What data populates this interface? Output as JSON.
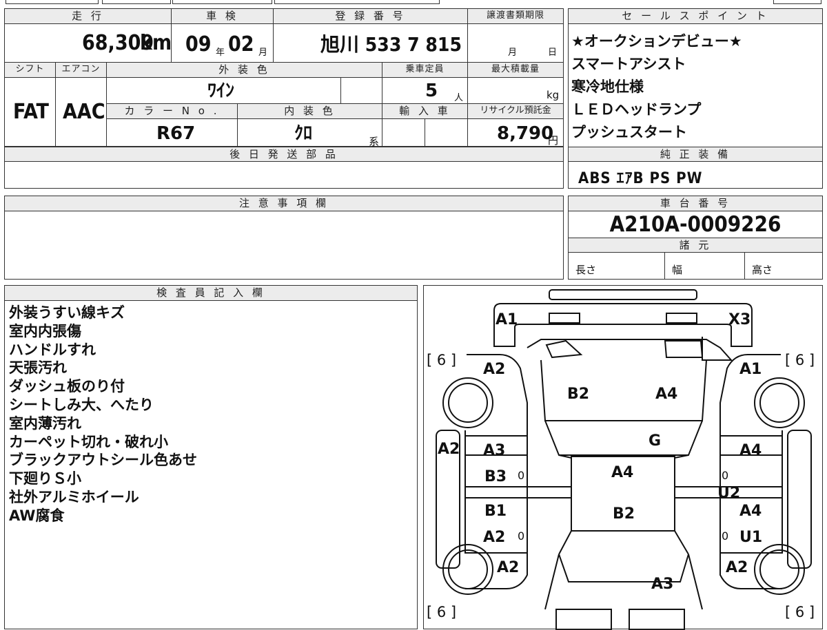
{
  "top_row": {
    "headers": {
      "mileage": "走 行",
      "inspection": "車 検",
      "registration": "登 録 番 号",
      "transfer_deadline": "譲渡書類期限"
    },
    "mileage": {
      "value": "68,309",
      "unit": "km"
    },
    "inspection": {
      "year": "09",
      "year_unit": "年",
      "month": "02",
      "month_unit": "月"
    },
    "registration": {
      "value": "旭川 533 7 815"
    },
    "transfer_deadline": {
      "month_unit": "月",
      "day_unit": "日"
    }
  },
  "second_row": {
    "headers": {
      "shift": "シフト",
      "aircon": "エアコン",
      "exterior_color": "外 装 色",
      "capacity": "乗車定員",
      "max_load": "最大積載量",
      "color_no": "カ ラ ー N o .",
      "interior_color": "内 装 色",
      "import": "輸 入 車",
      "recycle": "リサイクル預託金"
    },
    "shift": "FAT",
    "aircon": "AAC",
    "exterior_color": "ﾜｲﾝ",
    "capacity": {
      "value": "5",
      "unit": "人"
    },
    "max_load_unit": "kg",
    "color_no": "R67",
    "interior_color": {
      "value": "ｸﾛ",
      "suffix": "系"
    },
    "recycle": {
      "value": "8,790",
      "unit": "円"
    }
  },
  "later_parts": {
    "header": "後 日 発 送 部 品",
    "value": ""
  },
  "sales_points": {
    "header": "セ ー ル ス ポ イ ン ト",
    "items": [
      "★オークションデビュー★",
      "スマートアシスト",
      "寒冷地仕様",
      "ＬＥＤヘッドランプ",
      "プッシュスタート"
    ]
  },
  "standard_equipment": {
    "header": "純 正 装 備",
    "value": "ABS ｴｱB PS PW"
  },
  "caution": {
    "header": "注 意 事 項 欄",
    "value": ""
  },
  "chassis": {
    "header": "車 台 番 号",
    "value": "A210A-0009226"
  },
  "specs": {
    "header": "諸 元",
    "length": "長さ",
    "width": "幅",
    "height": "高さ"
  },
  "inspector": {
    "header": "検 査 員 記 入 欄",
    "notes": [
      "外装うすい線キズ",
      "室内内張傷",
      "ハンドルすれ",
      "天張汚れ",
      "ダッシュ板のり付",
      "シートしみ大、へたり",
      "室内薄汚れ",
      "カーペット切れ・破れ小",
      "ブラックアウトシール色あせ",
      "下廻りＳ小",
      "社外アルミホイール",
      "AW腐食"
    ]
  },
  "diagram": {
    "tire_depth": "[ 6 ]",
    "zero": "0",
    "labels": {
      "front_left_top": "A1",
      "front_right_top": "X3",
      "left_front_fender": "A2",
      "right_front_fender": "A1",
      "hood_left": "B2",
      "hood_right": "A4",
      "windshield": "G",
      "left_side": "A2",
      "left_front_door_1": "A3",
      "left_front_door_2": "B3",
      "left_rear_door_1": "B1",
      "left_rear_door_2": "A2",
      "roof_1": "A4",
      "roof_2": "B2",
      "right_front_door": "A4",
      "right_mid": "U2",
      "right_rear_door_1": "A4",
      "right_rear_door_2": "U1",
      "left_rear_fender": "A2",
      "right_rear_fender": "A2",
      "rear": "A3"
    }
  }
}
